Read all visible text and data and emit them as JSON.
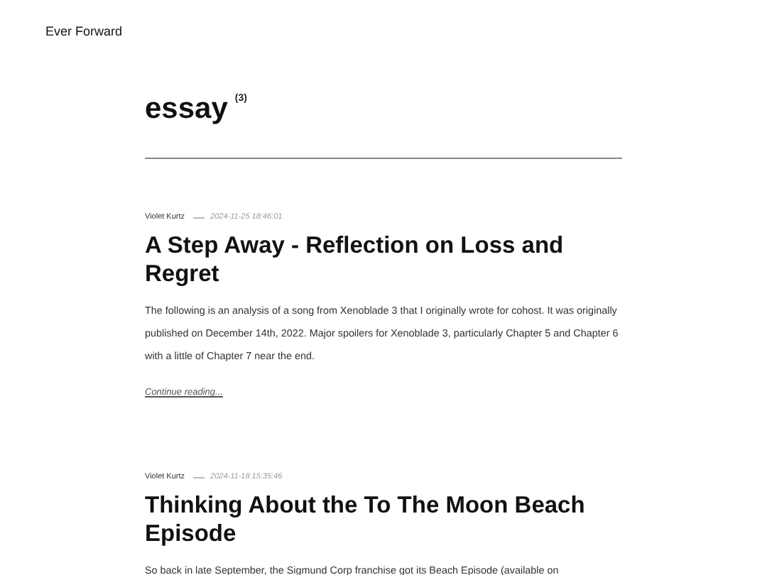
{
  "site": {
    "title": "Ever Forward"
  },
  "archive": {
    "title": "essay",
    "count": "(3)"
  },
  "posts": [
    {
      "author": "Violet Kurtz",
      "date": "2024-11-25 18:46:01",
      "title": "A Step Away - Reflection on Loss and Regret",
      "summary": "The following is an analysis of a song from Xenoblade 3 that I originally wrote for cohost. It was originally published on December 14th, 2022. Major spoilers for Xenoblade 3, particularly Chapter 5 and Chapter 6 with a little of Chapter 7 near the end.",
      "more": "Continue reading..."
    },
    {
      "author": "Violet Kurtz",
      "date": "2024-11-18 15:35:46",
      "title": "Thinking About the To The Moon Beach Episode",
      "summary": "So back in late September, the Sigmund Corp franchise got its Beach Episode (available on"
    }
  ]
}
